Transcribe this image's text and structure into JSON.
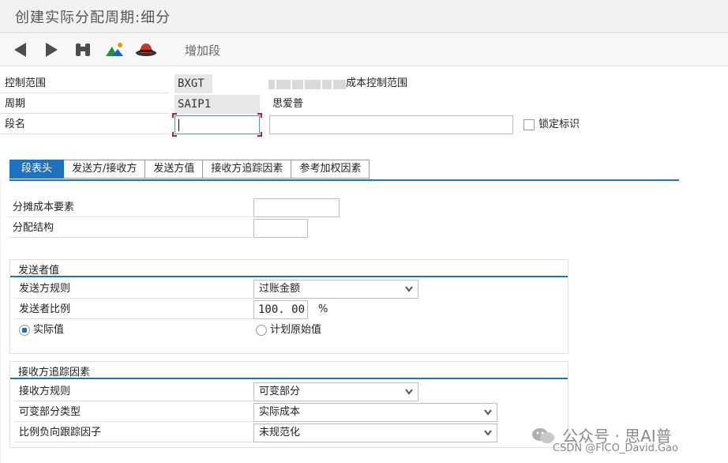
{
  "window": {
    "title": "创建实际分配周期:细分"
  },
  "toolbar": {
    "back_icon": "triangle-left-icon",
    "forward_icon": "triangle-right-icon",
    "find_icon": "binoculars-icon",
    "picture_icon": "picture-icon",
    "hat_icon": "hat-icon",
    "add_segment": "增加段"
  },
  "header": {
    "controlling_area": {
      "label": "控制范围",
      "value": "BXGT",
      "desc_suffix": "成本控制范围"
    },
    "cycle": {
      "label": "周期",
      "value": "SAIP1",
      "desc": "思爱普"
    },
    "segment": {
      "label": "段名",
      "name_value": "",
      "desc_value": "",
      "lock_label": "锁定标识",
      "lock_checked": false
    }
  },
  "tabs": [
    {
      "label": "段表头",
      "active": true
    },
    {
      "label": "发送方/接收方",
      "active": false
    },
    {
      "label": "发送方值",
      "active": false
    },
    {
      "label": "接收方追踪因素",
      "active": false
    },
    {
      "label": "参考加权因素",
      "active": false
    }
  ],
  "panel": {
    "alloc_cost_element": {
      "label": "分摊成本要素",
      "value": ""
    },
    "alloc_structure": {
      "label": "分配结构",
      "value": ""
    },
    "sender_values": {
      "title": "发送者值",
      "sender_rule": {
        "label": "发送方规则",
        "value": "过账金额"
      },
      "sender_share": {
        "label": "发送者比例",
        "value": "100. 00",
        "unit": "%"
      },
      "radio_actual": {
        "label": "实际值",
        "selected": true
      },
      "radio_plan": {
        "label": "计划原始值",
        "selected": false
      }
    },
    "receiver_tracing": {
      "title": "接收方追踪因素",
      "receiver_rule": {
        "label": "接收方规则",
        "value": "可变部分"
      },
      "var_portion_type": {
        "label": "可变部分类型",
        "value": "实际成本"
      },
      "neg_tracing": {
        "label": "比例负向跟踪因子",
        "value": "未规范化"
      }
    }
  },
  "watermark": {
    "text": "公众号 · 思AI普",
    "csdn": "CSDN @FICO_David.Gao"
  },
  "colors": {
    "accent": "#1f72bf",
    "focus_corner": "#b0203a"
  }
}
